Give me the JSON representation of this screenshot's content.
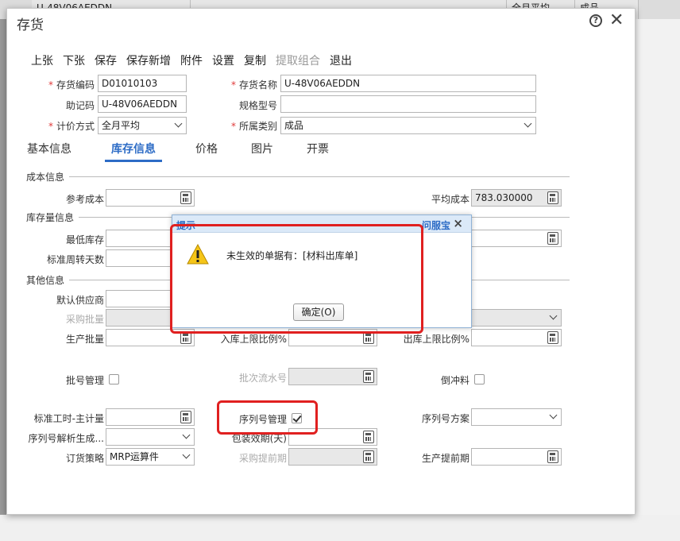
{
  "background": {
    "cells": [
      "U-48V06AEDDN",
      "",
      "全月平均",
      "成品"
    ],
    "cells_pos_note": ""
  },
  "window": {
    "title": "存货"
  },
  "toolbar": [
    "上张",
    "下张",
    "保存",
    "保存新增",
    "附件",
    "设置",
    "复制",
    "提取组合",
    "退出"
  ],
  "toolbar_disabled": [
    "提取组合"
  ],
  "header_fields": {
    "code_label": "存货编码",
    "code_value": "D01010103",
    "name_label": "存货名称",
    "name_value": "U-48V06AEDDN",
    "mnemonic_label": "助记码",
    "mnemonic_value": "U-48V06AEDDN",
    "spec_label": "规格型号",
    "spec_value": "",
    "pricing_label": "计价方式",
    "pricing_value": "全月平均",
    "category_label": "所属类别",
    "category_value": "成品"
  },
  "tabs": [
    "基本信息",
    "库存信息",
    "价格",
    "图片",
    "开票"
  ],
  "active_tab": "库存信息",
  "sections": {
    "cost": "成本信息",
    "stock": "库存量信息",
    "other": "其他信息"
  },
  "fields": {
    "ref_cost": "参考成本",
    "avg_cost": "平均成本",
    "avg_cost_value": "783.030000",
    "min_stock": "最低库存",
    "turnover_days": "标准周转天数",
    "default_supplier": "默认供应商",
    "purchase_batch": "采购批量",
    "production_batch": "生产批量",
    "inbound_limit": "入库上限比例%",
    "outbound_limit": "出库上限比例%",
    "batch_mgmt": "批号管理",
    "batch_serial": "批次流水号",
    "backflush": "倒冲料",
    "std_hours": "标准工时-主计量",
    "serial_mgmt": "序列号管理",
    "serial_scheme": "序列号方案",
    "serial_parse": "序列号解析生成...",
    "shelf_life": "包装效期(天)",
    "order_strategy": "订货策略",
    "order_strategy_value": "MRP运算件",
    "purchase_lead": "采购提前期",
    "production_lead": "生产提前期"
  },
  "popup": {
    "title": "提示",
    "link": "问服宝",
    "message": "未生效的单据有：[材料出库单]",
    "ok": "确定(O)"
  },
  "colors": {
    "accent": "#2d6cc6",
    "required": "#e03a3a",
    "highlight": "#e02020"
  }
}
